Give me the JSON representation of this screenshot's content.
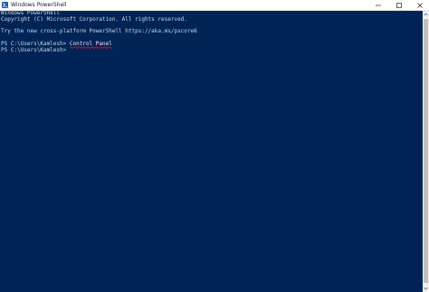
{
  "window": {
    "title": "Windows PowerShell",
    "icon": "powershell-icon",
    "controls": {
      "minimize_icon": "minimize-icon",
      "maximize_icon": "maximize-icon",
      "close_icon": "close-icon"
    }
  },
  "console": {
    "lines": [
      "Windows PowerShell",
      "Copyright (C) Microsoft Corporation. All rights reserved.",
      "",
      "Try the new cross-platform PowerShell https://aka.ms/pscore6",
      "",
      "PS C:\\Users\\Kamlesh> ",
      "PS C:\\Users\\Kamlesh> "
    ],
    "typed_command": "Control Panel",
    "background_color": "#012456",
    "text_color": "#cfd6e0",
    "error_underline_color": "#e81123"
  },
  "scrollbar": {
    "up_icon": "arrow-up-icon",
    "down_icon": "arrow-down-icon"
  }
}
